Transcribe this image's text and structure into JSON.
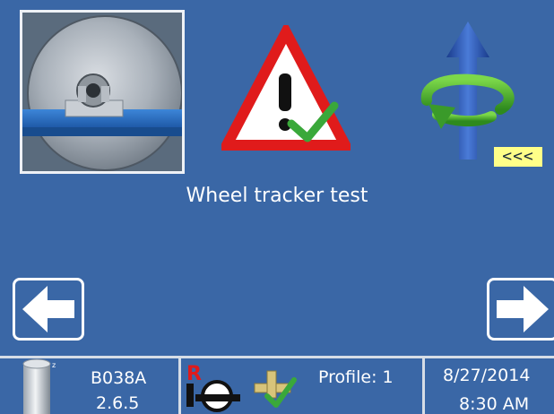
{
  "screen": {
    "title": "Wheel tracker test",
    "badge_text": "<<<"
  },
  "status": {
    "model": "B038A",
    "version": "2.6.5",
    "profile_label": "Profile:",
    "profile_value": "1",
    "date": "8/27/2014",
    "time": "8:30 AM"
  },
  "icons": {
    "photo": "wheel-tracker-photo",
    "warning": "warning-check-icon",
    "rotation": "rotate-arrow-icon",
    "back": "arrow-left-icon",
    "next": "arrow-right-icon",
    "sensor": "sensor-cylinder-icon",
    "mode": "r-tool-icon",
    "attachment": "attachment-check-icon"
  },
  "colors": {
    "background": "#3a67a6",
    "warning_red": "#e01b1b",
    "check_green": "#3aa83a",
    "badge_yellow": "#ffff88",
    "status_divider": "#d6dde6"
  }
}
